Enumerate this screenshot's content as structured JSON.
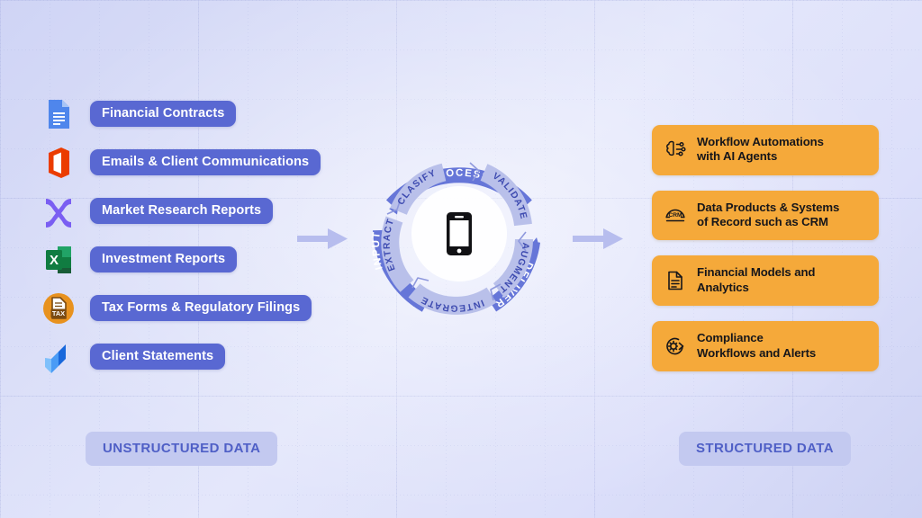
{
  "theme": {
    "blue_chip": "#5968d2",
    "orange_box": "#f5a93a",
    "pill_bg": "#c3c9f0",
    "pill_text": "#4f5fc6",
    "ring_outer": "#6676d8",
    "ring_inner": "#b9c0ea",
    "background": "#dcdff9"
  },
  "left": {
    "group_label": "UNSTRUCTURED DATA",
    "items": [
      {
        "label": "Financial Contracts",
        "icon": "google-docs-icon"
      },
      {
        "label": "Emails & Client Communications",
        "icon": "microsoft-office-icon"
      },
      {
        "label": "Market Research Reports",
        "icon": "xero-icon"
      },
      {
        "label": "Investment Reports",
        "icon": "microsoft-excel-icon"
      },
      {
        "label": "Tax Forms & Regulatory Filings",
        "icon": "tax-document-icon"
      },
      {
        "label": "Client Statements",
        "icon": "jira-icon"
      }
    ]
  },
  "right": {
    "group_label": "STRUCTURED DATA",
    "items": [
      {
        "label": "Workflow Automations\nwith AI Agents",
        "icon": "ai-brain-circuit-icon"
      },
      {
        "label": "Data Products & Systems\nof Record such as CRM",
        "icon": "crm-icon"
      },
      {
        "label": "Financial Models and\nAnalytics",
        "icon": "document-lines-icon"
      },
      {
        "label": "Compliance\nWorkflows and Alerts",
        "icon": "gear-arrow-icon"
      }
    ]
  },
  "center": {
    "core_icon": "smartphone-icon",
    "outer_ring": [
      "PROCESS",
      "DELIVER",
      "INPUT"
    ],
    "inner_ring": [
      "VALIDATE",
      "AUGMENT",
      "INTEGRATE",
      "CLASIFY",
      "EXTRACT"
    ]
  },
  "arrows": {
    "left_arrow": "arrow-right-icon",
    "right_arrow": "arrow-right-icon"
  }
}
